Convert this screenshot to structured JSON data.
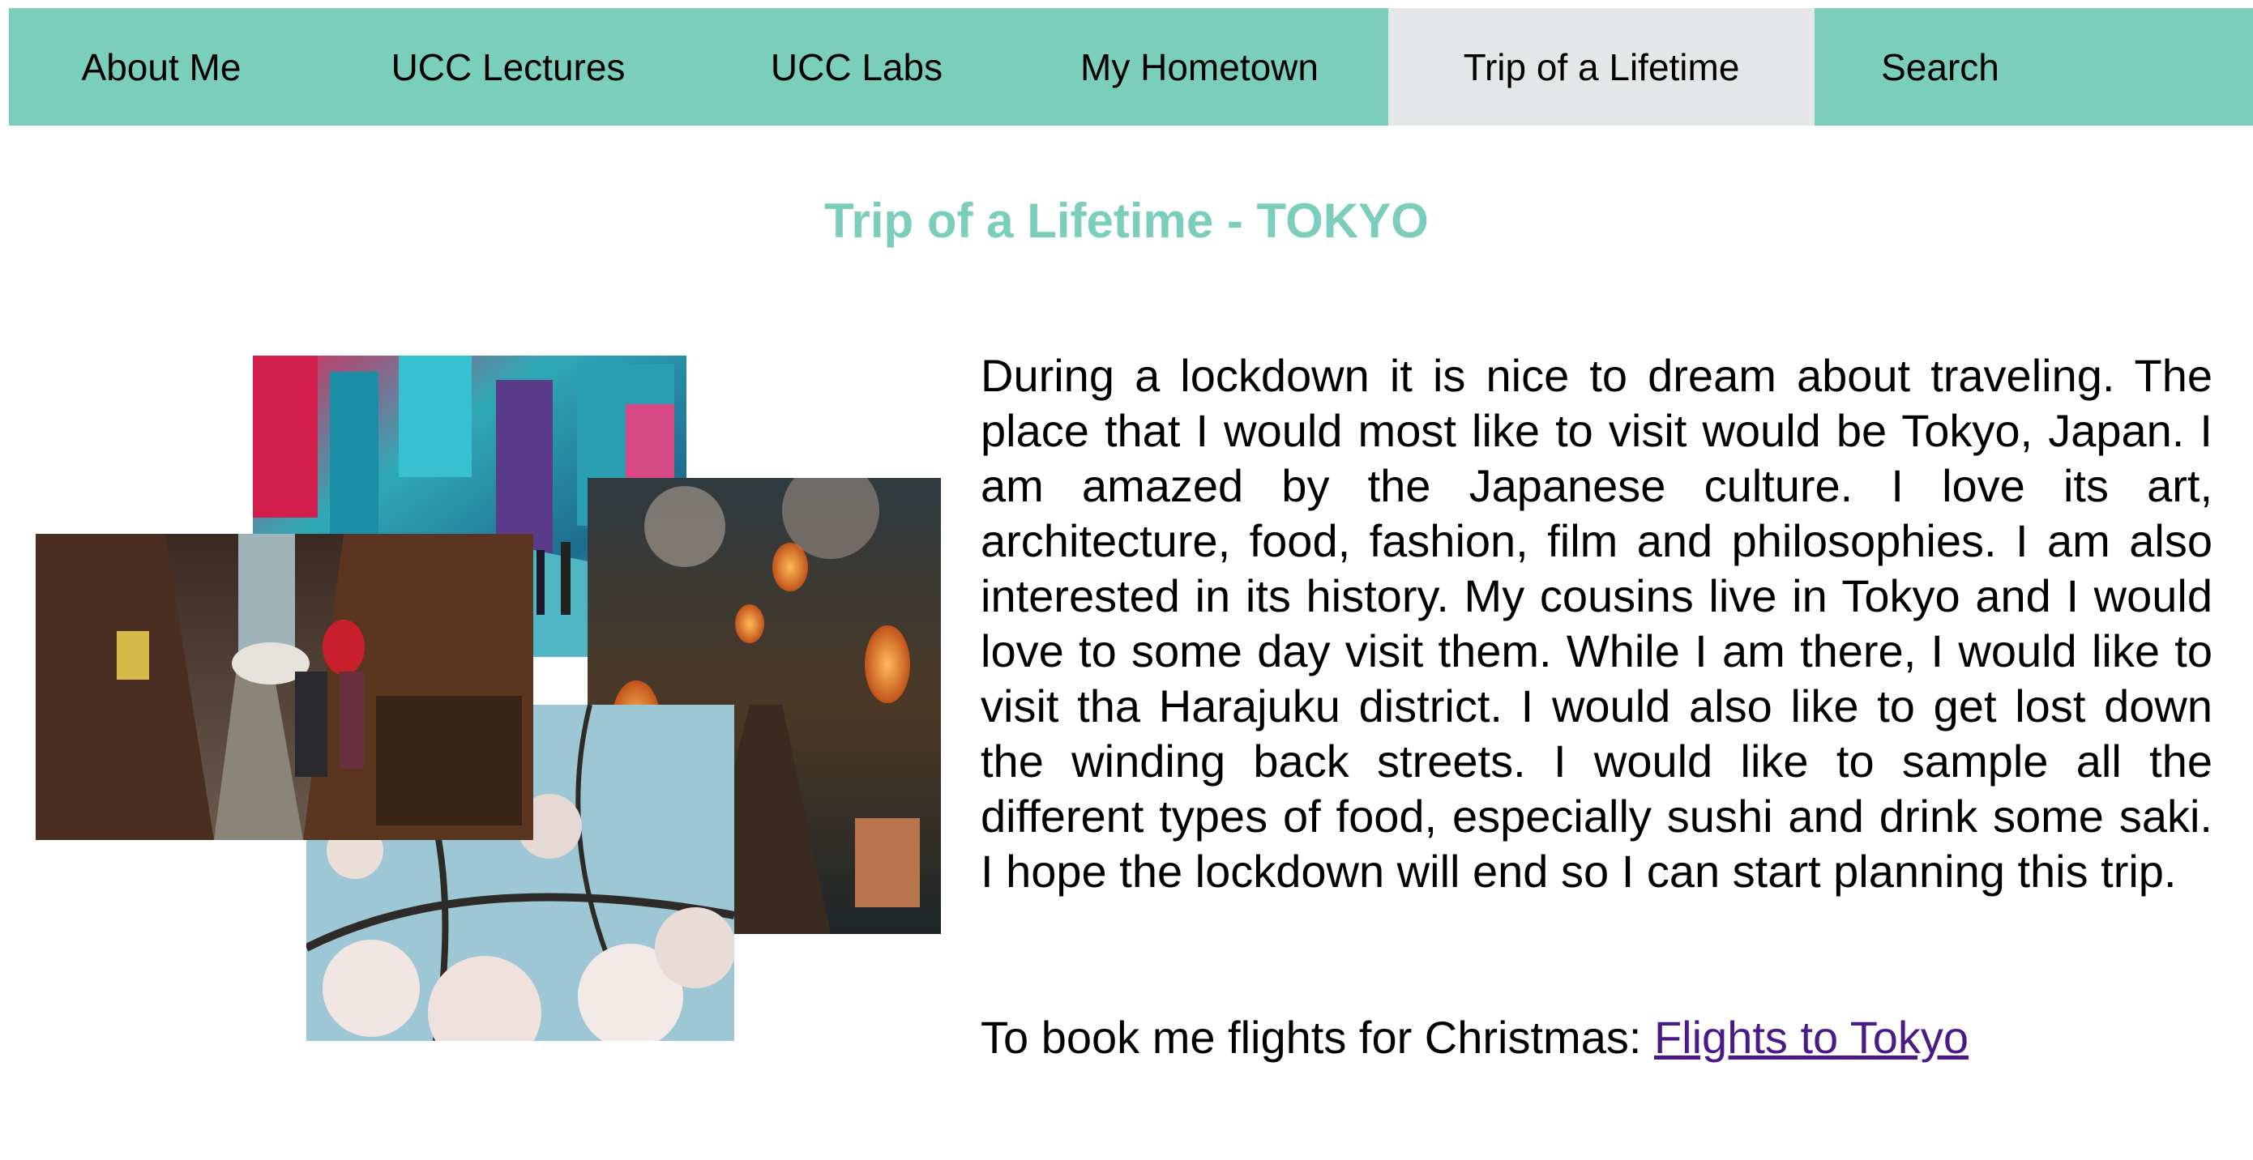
{
  "nav": {
    "items": [
      {
        "label": "About Me"
      },
      {
        "label": "UCC Lectures"
      },
      {
        "label": "UCC Labs"
      },
      {
        "label": "My Hometown"
      },
      {
        "label": "Trip of a Lifetime",
        "active": true
      },
      {
        "label": "Search"
      }
    ]
  },
  "page": {
    "title": "Trip of a Lifetime - TOKYO"
  },
  "article": {
    "body": "During a lockdown it is nice to dream about traveling. The place that I would most like to visit would be Tokyo, Japan. I am amazed by the Japanese culture. I love its art, architecture, food, fashion, film and philosophies. I am also interested in its history. My cousins live in Tokyo and I would love to some day visit them. While I am there, I would like to visit tha Harajuku district. I would also like to get lost down the winding back streets. I would like to sample all the different types of food, especially sushi and drink some saki. I hope the lockdown will end so I can start planning this trip.",
    "booking_prefix": "To book me flights for Christmas: ",
    "booking_link_label": "Flights to Tokyo"
  },
  "colors": {
    "nav_bg": "#7bcdbc",
    "nav_active_bg": "#e3e7e7",
    "title": "#7bcdbc",
    "link": "#4a1a8a"
  }
}
